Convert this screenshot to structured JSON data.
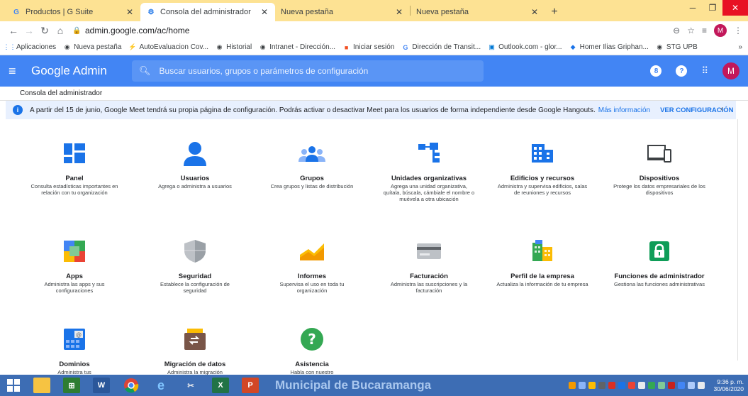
{
  "browser": {
    "tabs": [
      {
        "title": "Productos | G Suite"
      },
      {
        "title": "Consola del administrador"
      },
      {
        "title": "Nueva pestaña"
      },
      {
        "title": "Nueva pestaña"
      }
    ],
    "url": "admin.google.com/ac/home",
    "profile_initial": "M",
    "bookmarks": [
      "Aplicaciones",
      "Nueva pestaña",
      "AutoEvaluacion Cov...",
      "Historial",
      "Intranet - Dirección...",
      "Iniciar sesión",
      "Dirección de Transit...",
      "Outlook.com - glor...",
      "Homer Ilias Griphan...",
      "STG UPB"
    ]
  },
  "admin": {
    "brand": "Google Admin",
    "search_placeholder": "Buscar usuarios, grupos o parámetros de configuración",
    "notification_count": "8",
    "help": "?",
    "avatar_initial": "M",
    "breadcrumb": "Consola del administrador",
    "banner": {
      "text": "A partir del 15 de junio, Google Meet tendrá su propia página de configuración. Podrás activar o desactivar Meet para los usuarios de forma independiente desde Google Hangouts.",
      "link": "Más información",
      "action": "VER CONFIGURACIÓN"
    },
    "cards": [
      {
        "title": "Panel",
        "desc": "Consulta estadísticas importantes en relación con tu organización"
      },
      {
        "title": "Usuarios",
        "desc": "Agrega o administra a usuarios"
      },
      {
        "title": "Grupos",
        "desc": "Crea grupos y listas de distribución"
      },
      {
        "title": "Unidades organizativas",
        "desc": "Agrega una unidad organizativa, quítala, búscala, cámbiale el nombre o muévela a otra ubicación"
      },
      {
        "title": "Edificios y recursos",
        "desc": "Administra y supervisa edificios, salas de reuniones y recursos"
      },
      {
        "title": "Dispositivos",
        "desc": "Protege los datos empresariales de los dispositivos"
      },
      {
        "title": "Apps",
        "desc": "Administra las apps y sus configuraciones"
      },
      {
        "title": "Seguridad",
        "desc": "Establece la configuración de seguridad"
      },
      {
        "title": "Informes",
        "desc": "Supervisa el uso en toda tu organización"
      },
      {
        "title": "Facturación",
        "desc": "Administra las suscripciones y la facturación"
      },
      {
        "title": "Perfil de la empresa",
        "desc": "Actualiza la información de tu empresa"
      },
      {
        "title": "Funciones de administrador",
        "desc": "Gestiona las funciones administrativas"
      },
      {
        "title": "Dominios",
        "desc": "Administra tus"
      },
      {
        "title": "Migración de datos",
        "desc": "Administra la migración"
      },
      {
        "title": "Asistencia",
        "desc": "Habla con nuestro"
      }
    ]
  },
  "taskbar": {
    "watermark": "Municipal de Bucaramanga",
    "time": "9:36 p. m.",
    "date": "30/06/2020"
  },
  "colors": {
    "admin_blue": "#4285f4",
    "tab_strip": "#fde293",
    "taskbar": "#3d6db4"
  }
}
